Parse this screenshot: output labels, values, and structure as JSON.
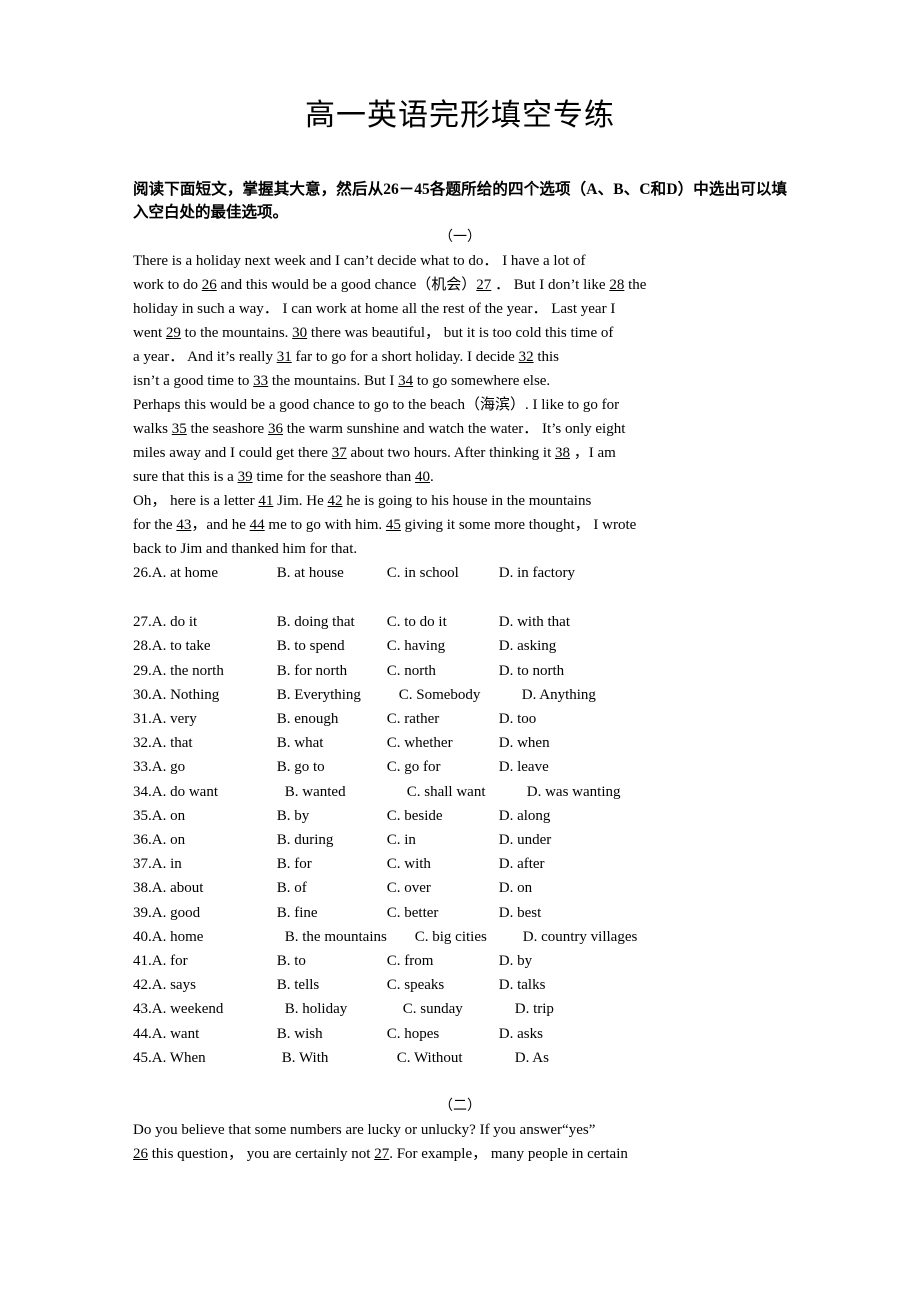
{
  "document": {
    "title": "高一英语完形填空专练",
    "instructions": "阅读下面短文，掌握其大意，然后从26－45各题所给的四个选项（A、B、C和D）中选出可以填入空白处的最佳选项。"
  },
  "sections": [
    {
      "marker": "（一）",
      "paragraphs": [
        "There is a holiday next week and I can’t decide what to do．    I have a lot of work to do 26 and this would be a good chance（机会）27 ．   But I don’t like 28 the holiday in such a way．    I can work at home all the rest of the year．    Last year I went 29 to the mountains.  30 there was beautiful，  but it is too cold this time of a year．   And it’s really 31 far to go for a short holiday.   I decide 32 this isn’t a good time to 33 the mountains.    But I 34 to go somewhere else.",
        "Perhaps this would be a good chance to go to the beach（海滨）.  I like to go for walks 35 the seashore 36 the warm sunshine and watch the water．   It’s only eight miles away and I could get there 37 about two hours.    After thinking it 38 ，I am sure that this is a 39 time for the seashore than 40.",
        "Oh，  here is a letter 41 Jim.    He 42 he is going to his house in the mountains for the 43，and he 44 me to go with him.  45 giving it some more thought，  I wrote back to Jim and thanked him for that."
      ],
      "questions": [
        {
          "num": "26.",
          "options": [
            "A. at home",
            "B. at house",
            "C. in school",
            "D. in factory"
          ]
        },
        {
          "num": "27.",
          "options": [
            "A. do it",
            "B. doing that",
            "C. to do it",
            "D. with that"
          ]
        },
        {
          "num": "28.",
          "options": [
            "A. to take",
            "B. to spend",
            "C. having",
            "D. asking"
          ]
        },
        {
          "num": "29.",
          "options": [
            "A. the north",
            "B. for north",
            "C. north",
            "D. to north"
          ]
        },
        {
          "num": "30.",
          "options": [
            "A. Nothing",
            "B. Everything",
            "C. Somebody",
            "D. Anything"
          ]
        },
        {
          "num": "31.",
          "options": [
            "A. very",
            "B. enough",
            "C. rather",
            "D. too"
          ]
        },
        {
          "num": "32.",
          "options": [
            "A. that",
            "B. what",
            "C. whether",
            "D. when"
          ]
        },
        {
          "num": "33.",
          "options": [
            "A. go",
            "B. go to",
            "C. go for",
            "D. leave"
          ]
        },
        {
          "num": "34.",
          "options": [
            "A. do want",
            "B. wanted",
            "C. shall want",
            "D. was wanting"
          ]
        },
        {
          "num": "35.",
          "options": [
            "A. on",
            "B. by",
            "C. beside",
            "D. along"
          ]
        },
        {
          "num": "36.",
          "options": [
            "A. on",
            "B. during",
            "C. in",
            "D. under"
          ]
        },
        {
          "num": "37.",
          "options": [
            "A. in",
            "B. for",
            "C. with",
            "D. after"
          ]
        },
        {
          "num": "38.",
          "options": [
            "A. about",
            "B. of",
            "C. over",
            "D. on"
          ]
        },
        {
          "num": "39.",
          "options": [
            "A. good",
            "B. fine",
            "C. better",
            "D. best"
          ]
        },
        {
          "num": "40.",
          "options": [
            "A. home",
            "B. the mountains",
            "C. big cities",
            "D. country villages"
          ]
        },
        {
          "num": "41.",
          "options": [
            "A. for",
            "B. to",
            "C. from",
            "D. by"
          ]
        },
        {
          "num": "42.",
          "options": [
            "A. says",
            "B. tells",
            "C. speaks",
            "D. talks"
          ]
        },
        {
          "num": "43.",
          "options": [
            "A. weekend",
            "B. holiday",
            "C. sunday",
            "D. trip"
          ]
        },
        {
          "num": "44.",
          "options": [
            "A. want",
            "B. wish",
            "C. hopes",
            "D. asks"
          ]
        },
        {
          "num": "45.",
          "options": [
            "A. When",
            "B. With",
            "C. Without",
            "D. As"
          ]
        }
      ]
    },
    {
      "marker": "（二）",
      "paragraphs": [
        "Do you believe that some numbers are lucky or unlucky?   If you answer“yes”26 this question，  you are certainly not 27. For example，  many people in certain"
      ],
      "questions": []
    }
  ],
  "passage_lines": {
    "s1": [
      [
        {
          "t": "  There is a holiday next week and I can’t decide what to do．"
        },
        {
          "t": "    ",
          "sp": true
        },
        {
          "t": "I have a lot of"
        }
      ],
      [
        {
          "t": "work to do "
        },
        {
          "t": "26",
          "u": true
        },
        {
          "t": " and this would be a good chance（机会）"
        },
        {
          "t": "27",
          "u": true
        },
        {
          "t": " ．    But I don’t like "
        },
        {
          "t": "28",
          "u": true
        },
        {
          "t": " the"
        }
      ],
      [
        {
          "t": "holiday in such a way．    I can work at home all the rest of the year．    Last year I"
        }
      ],
      [
        {
          "t": "went "
        },
        {
          "t": "29",
          "u": true
        },
        {
          "t": " to the mountains.   "
        },
        {
          "t": "30",
          "u": true
        },
        {
          "t": " there was beautiful，  but it is too cold this time of"
        }
      ],
      [
        {
          "t": "a year．   And it’s really "
        },
        {
          "t": "31",
          "u": true
        },
        {
          "t": " far to go for a short holiday.    I decide "
        },
        {
          "t": "32",
          "u": true
        },
        {
          "t": " this"
        }
      ],
      [
        {
          "t": "isn’t a good time to "
        },
        {
          "t": "33",
          "u": true
        },
        {
          "t": " the mountains.    But I "
        },
        {
          "t": "34",
          "u": true
        },
        {
          "t": " to go somewhere else."
        }
      ]
    ],
    "s2": [
      [
        {
          "t": "   Perhaps this would be a good chance to go to the beach（海滨）.  I like to go for"
        }
      ],
      [
        {
          "t": "walks "
        },
        {
          "t": "35",
          "u": true
        },
        {
          "t": " the seashore "
        },
        {
          "t": "36",
          "u": true
        },
        {
          "t": " the warm sunshine and watch the water．    It’s only eight"
        }
      ],
      [
        {
          "t": "miles away and I could get there "
        },
        {
          "t": "37",
          "u": true
        },
        {
          "t": " about two hours.    After thinking it "
        },
        {
          "t": "38",
          "u": true
        },
        {
          "t": " ，I am"
        }
      ],
      [
        {
          "t": "sure that this is a "
        },
        {
          "t": "39",
          "u": true
        },
        {
          "t": " time for the seashore than "
        },
        {
          "t": "40",
          "u": true
        },
        {
          "t": "."
        }
      ]
    ],
    "s3": [
      [
        {
          "t": "    Oh，  here is a letter "
        },
        {
          "t": "41",
          "u": true
        },
        {
          "t": " Jim.    He "
        },
        {
          "t": "42",
          "u": true
        },
        {
          "t": " he is going to his house in the mountains"
        }
      ],
      [
        {
          "t": "for the "
        },
        {
          "t": "43",
          "u": true
        },
        {
          "t": "，and he "
        },
        {
          "t": "44",
          "u": true
        },
        {
          "t": " me to go with him.   "
        },
        {
          "t": "45",
          "u": true
        },
        {
          "t": " giving it some more thought，   I wrote"
        }
      ],
      [
        {
          "t": "back to Jim and thanked him for that."
        }
      ]
    ],
    "s4": [
      [
        {
          "t": "    Do you believe that some numbers are lucky or unlucky?    If you answer“yes”"
        }
      ],
      [
        {
          "t": "26",
          "u": true
        },
        {
          "t": " this question，   you are certainly not "
        },
        {
          "t": "27",
          "u": true
        },
        {
          "t": ".  For example，    many people in certain"
        }
      ]
    ]
  },
  "option_rows": [
    {
      "num": "26. ",
      "cols": [
        "A. at home",
        "B. at house",
        "C. in school",
        "D. in factory"
      ],
      "widths": [
        125,
        110,
        112
      ]
    },
    {
      "num": "27. ",
      "cols": [
        "A. do it",
        "B. doing that",
        "C. to do it",
        "D. with that"
      ],
      "widths": [
        125,
        110,
        112
      ]
    },
    {
      "num": "28. ",
      "cols": [
        "A. to take",
        "B. to spend",
        "C. having",
        "D. asking"
      ],
      "widths": [
        125,
        110,
        112
      ]
    },
    {
      "num": "29. ",
      "cols": [
        "A. the north",
        "B. for north",
        "C. north",
        "D. to north"
      ],
      "widths": [
        125,
        110,
        112
      ]
    },
    {
      "num": "30. ",
      "cols": [
        "A. Nothing",
        "B. Everything",
        "C. Somebody",
        "D. Anything"
      ],
      "widths": [
        125,
        122,
        123
      ]
    },
    {
      "num": "31. ",
      "cols": [
        "A. very",
        "B. enough",
        "C. rather",
        "D. too"
      ],
      "widths": [
        125,
        110,
        112
      ]
    },
    {
      "num": "32. ",
      "cols": [
        "A. that",
        "B. what",
        "C. whether",
        "D. when"
      ],
      "widths": [
        125,
        110,
        112
      ]
    },
    {
      "num": "33. ",
      "cols": [
        "A. go",
        "B. go to",
        "C. go for",
        "D. leave"
      ],
      "widths": [
        125,
        110,
        112
      ]
    },
    {
      "num": "34. ",
      "cols": [
        "A. do want",
        "B. wanted",
        "C. shall want",
        "D. was wanting"
      ],
      "widths": [
        133,
        122,
        120
      ]
    },
    {
      "num": "35. ",
      "cols": [
        "A. on",
        "B. by",
        "C. beside",
        "D. along"
      ],
      "widths": [
        125,
        110,
        112
      ]
    },
    {
      "num": "36. ",
      "cols": [
        "A. on",
        "B. during",
        "C. in",
        "D. under"
      ],
      "widths": [
        125,
        110,
        112
      ]
    },
    {
      "num": "37. ",
      "cols": [
        "A. in",
        "B. for",
        "C. with",
        "D. after"
      ],
      "widths": [
        125,
        110,
        112
      ]
    },
    {
      "num": "38. ",
      "cols": [
        "A. about",
        "B. of",
        "C. over",
        "D. on"
      ],
      "widths": [
        125,
        110,
        112
      ]
    },
    {
      "num": "39. ",
      "cols": [
        "A. good",
        "B. fine",
        "C. better",
        "D. best"
      ],
      "widths": [
        125,
        110,
        112
      ]
    },
    {
      "num": "40. ",
      "cols": [
        "A. home",
        "B. the mountains",
        "C. big cities",
        "D. country villages"
      ],
      "widths": [
        133,
        130,
        108
      ]
    },
    {
      "num": "41. ",
      "cols": [
        "A. for",
        "B. to",
        "C. from",
        "D. by"
      ],
      "widths": [
        125,
        110,
        112
      ]
    },
    {
      "num": "42. ",
      "cols": [
        "A. says",
        "B. tells",
        "C. speaks",
        "D. talks"
      ],
      "widths": [
        125,
        110,
        112
      ]
    },
    {
      "num": "43. ",
      "cols": [
        "A. weekend",
        "B. holiday",
        "C. sunday",
        "D. trip"
      ],
      "widths": [
        133,
        118,
        112
      ]
    },
    {
      "num": "44. ",
      "cols": [
        "A. want",
        "B. wish",
        "C. hopes",
        "D. asks"
      ],
      "widths": [
        125,
        110,
        112
      ]
    },
    {
      "num": "45. ",
      "cols": [
        "A. When",
        "B. With",
        "C. Without",
        "D. As"
      ],
      "widths": [
        130,
        115,
        118
      ]
    }
  ]
}
